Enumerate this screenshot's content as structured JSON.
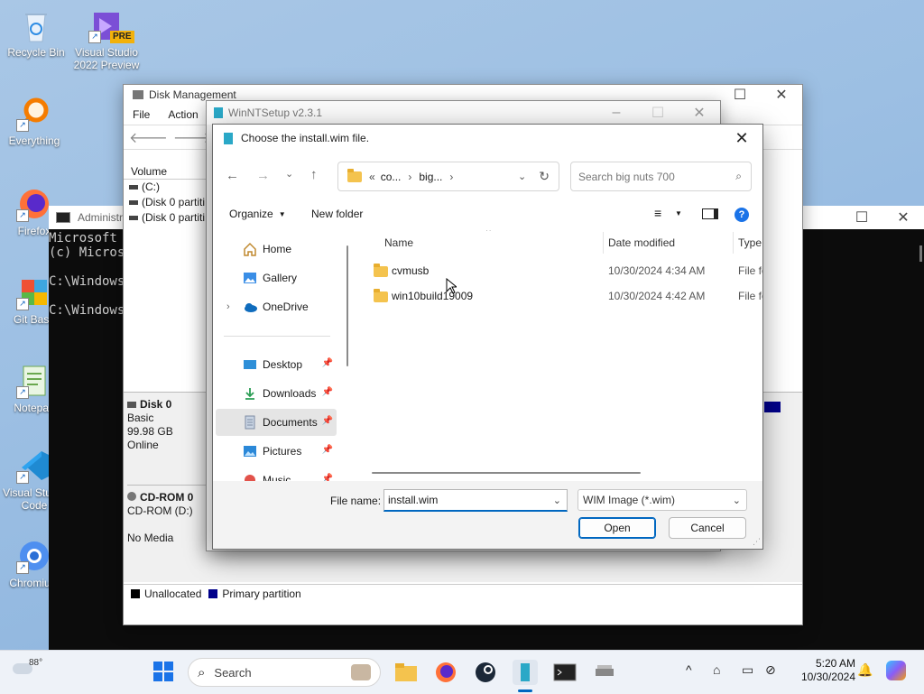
{
  "desktop": {
    "icons": [
      {
        "label": "Recycle Bin"
      },
      {
        "label": "Visual Studio 2022 Preview"
      },
      {
        "label": "Everything"
      },
      {
        "label": "Firefox"
      },
      {
        "label": "Git Bash"
      },
      {
        "label": "Notepad"
      },
      {
        "label": "Visual Studio Code"
      },
      {
        "label": "Chromium"
      }
    ],
    "vs_badge": "PRE"
  },
  "cmd": {
    "title": "Administrator",
    "lines": [
      "Microsoft (",
      "(c) Micros",
      "",
      "C:\\Windows",
      "",
      "C:\\Windows"
    ]
  },
  "disk_management": {
    "title": "Disk Management",
    "menu": [
      "File",
      "Action"
    ],
    "column_volume": "Volume",
    "volumes": [
      "(C:)",
      "(Disk 0 partiti",
      "(Disk 0 partiti"
    ],
    "disk0": {
      "name": "Disk 0",
      "type": "Basic",
      "size": "99.98 GB",
      "status": "Online"
    },
    "cdrom0": {
      "name": "CD-ROM 0",
      "drive": "CD-ROM (D:)",
      "status": "No Media"
    },
    "legend": {
      "unallocated": "Unallocated",
      "primary": "Primary partition"
    }
  },
  "winntsetup": {
    "title": "WinNTSetup v2.3.1"
  },
  "dialog": {
    "title": "Choose the install.wim file.",
    "breadcrumb": {
      "prefix": "«",
      "parts": [
        "co...",
        "big...",
        ""
      ]
    },
    "search_placeholder": "Search big nuts 700",
    "toolbar": {
      "organize": "Organize",
      "new_folder": "New folder"
    },
    "sidebar": [
      {
        "label": "Home"
      },
      {
        "label": "Gallery"
      },
      {
        "label": "OneDrive"
      },
      {
        "label": "Desktop"
      },
      {
        "label": "Downloads"
      },
      {
        "label": "Documents"
      },
      {
        "label": "Pictures"
      },
      {
        "label": "Music"
      }
    ],
    "columns": {
      "name": "Name",
      "date": "Date modified",
      "type": "Type"
    },
    "files": [
      {
        "name": "cvmusb",
        "date": "10/30/2024 4:34 AM",
        "type": "File fo"
      },
      {
        "name": "win10build19009",
        "date": "10/30/2024 4:42 AM",
        "type": "File fo"
      }
    ],
    "filename_label": "File name:",
    "filename_value": "install.wim",
    "filter_value": "WIM Image (*.wim)",
    "open_label": "Open",
    "cancel_label": "Cancel"
  },
  "taskbar": {
    "weather": "88°",
    "search_label": "Search",
    "time": "5:20 AM",
    "date": "10/30/2024"
  },
  "colors": {
    "accent": "#0067c0",
    "primary_partition": "#00008b"
  }
}
